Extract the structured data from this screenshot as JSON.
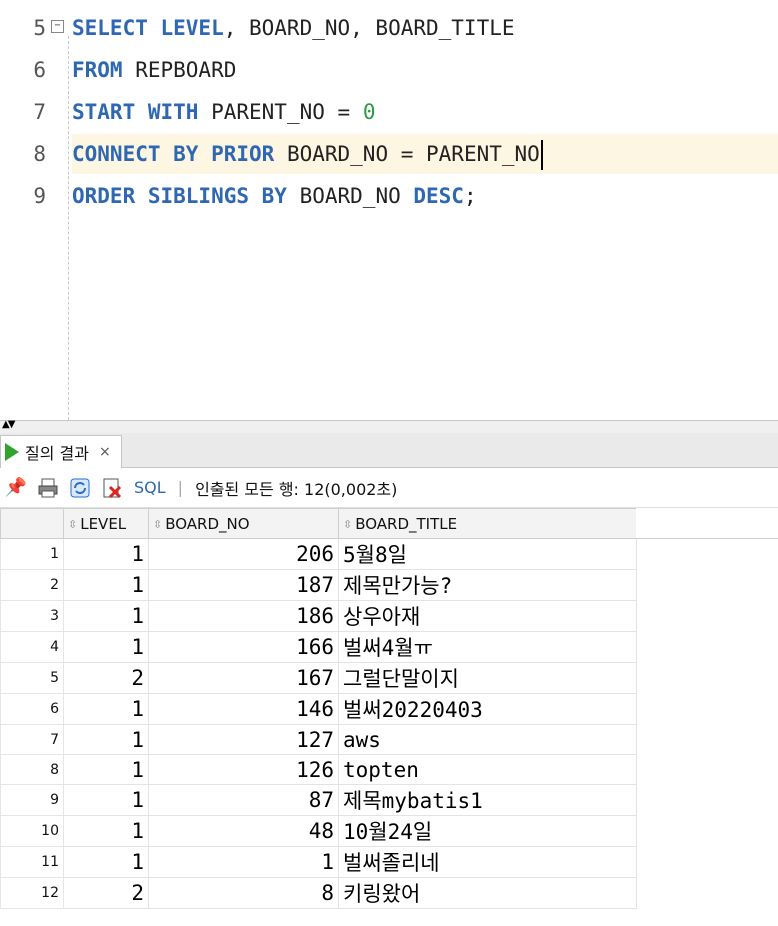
{
  "editor": {
    "lines": [
      {
        "num": "5",
        "parts": [
          {
            "t": "SELECT LEVEL",
            "c": "kw"
          },
          {
            "t": ", BOARD_NO, BOARD_TITLE",
            "c": ""
          }
        ]
      },
      {
        "num": "6",
        "parts": [
          {
            "t": "FROM",
            "c": "kw"
          },
          {
            "t": " REPBOARD",
            "c": ""
          }
        ]
      },
      {
        "num": "7",
        "parts": [
          {
            "t": "START WITH",
            "c": "kw"
          },
          {
            "t": " PARENT_NO = ",
            "c": ""
          },
          {
            "t": "0",
            "c": "num"
          }
        ]
      },
      {
        "num": "8",
        "parts": [
          {
            "t": "CONNECT BY PRIOR",
            "c": "kw"
          },
          {
            "t": " BOARD_NO = PARENT_NO",
            "c": ""
          }
        ],
        "current": true
      },
      {
        "num": "9",
        "parts": [
          {
            "t": "ORDER SIBLINGS BY",
            "c": "kw"
          },
          {
            "t": " BOARD_NO ",
            "c": ""
          },
          {
            "t": "DESC",
            "c": "kw"
          },
          {
            "t": ";",
            "c": ""
          }
        ]
      }
    ]
  },
  "results_tab": {
    "label": "질의 결과",
    "close": "×"
  },
  "toolbar": {
    "sql_label": "SQL",
    "separator": "|",
    "status": "인출된 모든 행: 12(0,002초)"
  },
  "grid": {
    "columns": [
      "LEVEL",
      "BOARD_NO",
      "BOARD_TITLE"
    ],
    "rows": [
      {
        "n": "1",
        "level": "1",
        "board_no": "206",
        "title": "5월8일"
      },
      {
        "n": "2",
        "level": "1",
        "board_no": "187",
        "title": "제목만가능?"
      },
      {
        "n": "3",
        "level": "1",
        "board_no": "186",
        "title": "상우아재"
      },
      {
        "n": "4",
        "level": "1",
        "board_no": "166",
        "title": "벌써4월ㅠ"
      },
      {
        "n": "5",
        "level": "2",
        "board_no": "167",
        "title": "그럴단말이지"
      },
      {
        "n": "6",
        "level": "1",
        "board_no": "146",
        "title": "벌써20220403"
      },
      {
        "n": "7",
        "level": "1",
        "board_no": "127",
        "title": "aws"
      },
      {
        "n": "8",
        "level": "1",
        "board_no": "126",
        "title": "topten"
      },
      {
        "n": "9",
        "level": "1",
        "board_no": "87",
        "title": "제목mybatis1"
      },
      {
        "n": "10",
        "level": "1",
        "board_no": "48",
        "title": "10월24일"
      },
      {
        "n": "11",
        "level": "1",
        "board_no": "1",
        "title": "벌써졸리네"
      },
      {
        "n": "12",
        "level": "2",
        "board_no": "8",
        "title": "키링왔어"
      }
    ]
  }
}
